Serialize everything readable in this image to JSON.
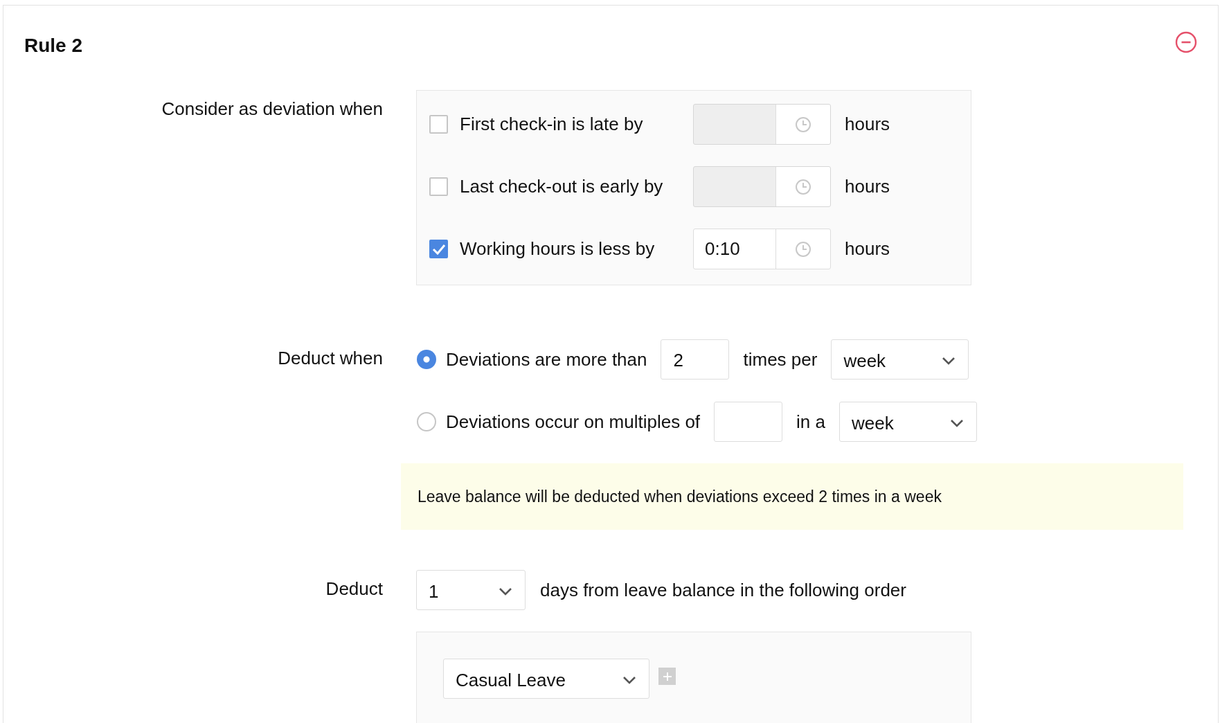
{
  "rule": {
    "title": "Rule 2"
  },
  "deviation": {
    "label": "Consider as deviation when",
    "conditions": [
      {
        "label": "First check-in is late by",
        "checked": false,
        "disabled": true,
        "unit": "hours"
      },
      {
        "label": "Last check-out is early by",
        "checked": false,
        "disabled": true,
        "unit": "hours"
      },
      {
        "label": "Working hours is less by",
        "checked": true,
        "disabled": false,
        "value": "0:10",
        "unit": "hours"
      }
    ]
  },
  "deduct_when": {
    "label": "Deduct when",
    "options": [
      {
        "label": "Deviations are more than",
        "selected": true,
        "value": "2",
        "connector": "times per",
        "period": "week"
      },
      {
        "label": "Deviations occur on multiples of",
        "selected": false,
        "connector": "in a",
        "period": "week"
      }
    ],
    "notice": "Leave balance will be deducted when deviations exceed 2 times in a week"
  },
  "deduct": {
    "label": "Deduct",
    "amount": "1",
    "text": "days from leave balance in the following order",
    "leave_types": [
      "Casual Leave"
    ]
  }
}
